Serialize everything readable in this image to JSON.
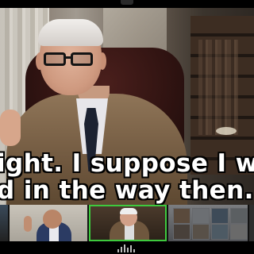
{
  "meeting": {
    "caption": {
      "line1": "ight. I suppose I w",
      "line2": "d in the way then."
    },
    "participants": [
      {
        "role": "partial-left"
      },
      {
        "role": "raising-hand"
      },
      {
        "role": "active-speaker"
      },
      {
        "role": "gallery-room"
      },
      {
        "role": "partial-right"
      }
    ]
  },
  "colors": {
    "active_speaker_border": "#3ec93e",
    "caption_text": "#ffffff",
    "caption_outline": "#000000"
  },
  "icons": {
    "audio": "audio-level-icon",
    "camera": "camera-notch"
  }
}
